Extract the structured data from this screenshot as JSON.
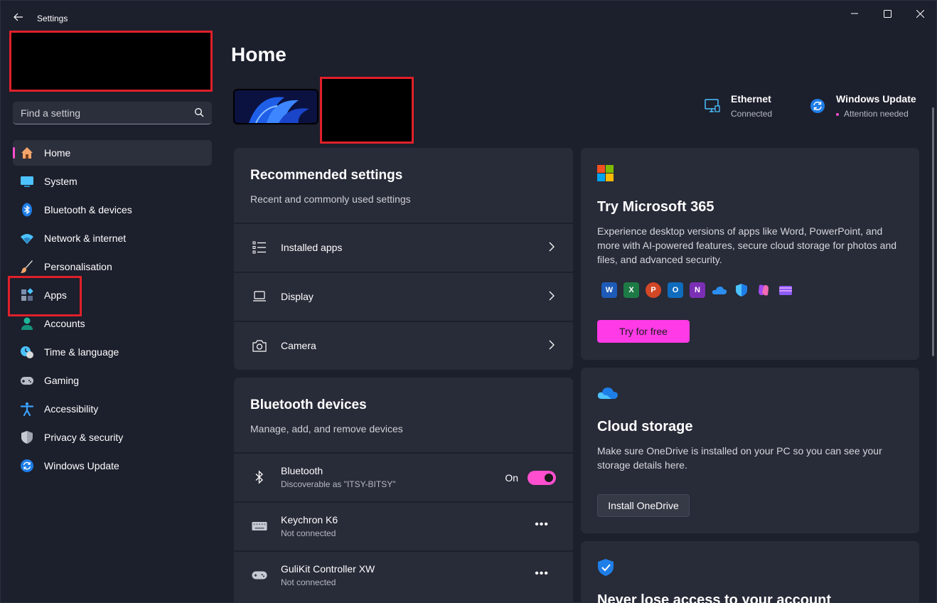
{
  "window": {
    "title": "Settings"
  },
  "search": {
    "placeholder": "Find a setting"
  },
  "sidebar": {
    "items": [
      {
        "label": "Home"
      },
      {
        "label": "System"
      },
      {
        "label": "Bluetooth & devices"
      },
      {
        "label": "Network & internet"
      },
      {
        "label": "Personalisation"
      },
      {
        "label": "Apps"
      },
      {
        "label": "Accounts"
      },
      {
        "label": "Time & language"
      },
      {
        "label": "Gaming"
      },
      {
        "label": "Accessibility"
      },
      {
        "label": "Privacy & security"
      },
      {
        "label": "Windows Update"
      }
    ]
  },
  "main": {
    "title": "Home",
    "status": {
      "ethernet": {
        "title": "Ethernet",
        "sub": "Connected"
      },
      "update": {
        "title": "Windows Update",
        "sub": "Attention needed"
      }
    },
    "recommended": {
      "title": "Recommended settings",
      "sub": "Recent and commonly used settings",
      "rows": [
        {
          "label": "Installed apps"
        },
        {
          "label": "Display"
        },
        {
          "label": "Camera"
        }
      ]
    },
    "bluetooth": {
      "title": "Bluetooth devices",
      "sub": "Manage, add, and remove devices",
      "rows": [
        {
          "label": "Bluetooth",
          "sub": "Discoverable as \"ITSY-BITSY\"",
          "state": "On"
        },
        {
          "label": "Keychron K6",
          "sub": "Not connected"
        },
        {
          "label": "GuliKit Controller XW",
          "sub": "Not connected"
        }
      ]
    },
    "m365": {
      "title": "Try Microsoft 365",
      "text": "Experience desktop versions of apps like Word, PowerPoint, and more with AI-powered features, secure cloud storage for photos and files, and advanced security.",
      "button": "Try for free"
    },
    "cloud": {
      "title": "Cloud storage",
      "text": "Make sure OneDrive is installed on your PC so you can see your storage details here.",
      "button": "Install OneDrive"
    },
    "account": {
      "title": "Never lose access to your account"
    }
  },
  "colors": {
    "accent": "#ff4fcf",
    "background": "#1c1f2c",
    "card": "#282b38"
  }
}
